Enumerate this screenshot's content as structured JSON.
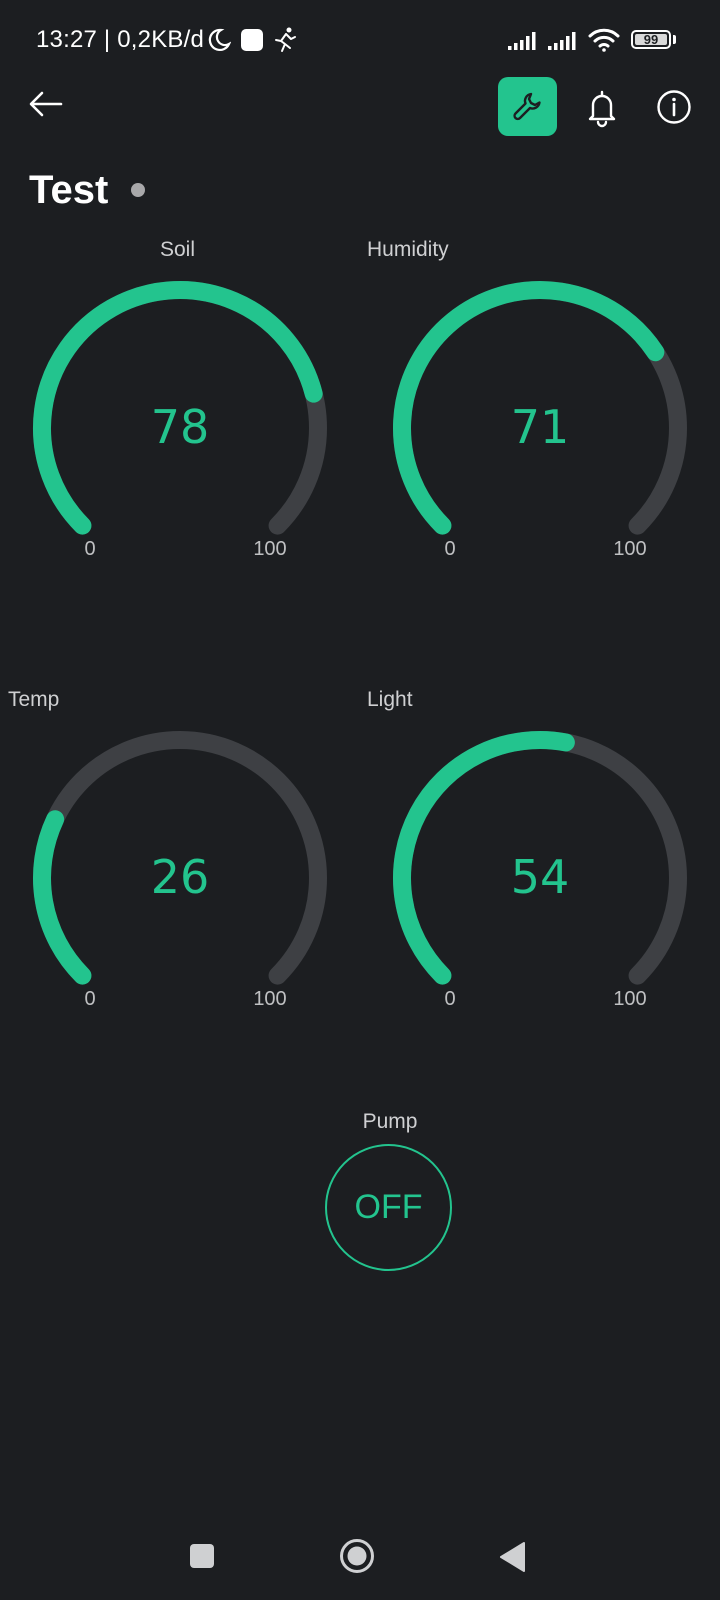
{
  "status_bar": {
    "time_and_rate": "13:27 | 0,2KB/d",
    "battery_level": "99",
    "icons": [
      "moon-icon",
      "app-notification-icon",
      "runner-icon",
      "signal-icon",
      "signal-icon",
      "wifi-icon",
      "battery-icon"
    ]
  },
  "app_bar": {
    "icons": [
      "back-arrow-icon",
      "wrench-icon",
      "bell-icon",
      "info-icon"
    ],
    "accent": "#23c48e"
  },
  "device": {
    "title": "Test",
    "status_color": "#a8a8aa"
  },
  "gauges": [
    {
      "label": "Soil",
      "value": "78",
      "min": "0",
      "max": "100",
      "level": 0.78
    },
    {
      "label": "Humidity",
      "value": "71",
      "min": "0",
      "max": "100",
      "level": 0.71
    },
    {
      "label": "Temp",
      "value": "26",
      "min": "0",
      "max": "100",
      "level": 0.26
    },
    {
      "label": "Light",
      "value": "54",
      "min": "0",
      "max": "100",
      "level": 0.54
    }
  ],
  "pump": {
    "label": "Pump",
    "state": "OFF"
  },
  "colors": {
    "background": "#1c1e21",
    "accent": "#23c48e",
    "track": "#3e4044"
  },
  "nav_bar": {
    "icons": [
      "recents-square-icon",
      "home-circle-icon",
      "back-triangle-icon"
    ]
  }
}
